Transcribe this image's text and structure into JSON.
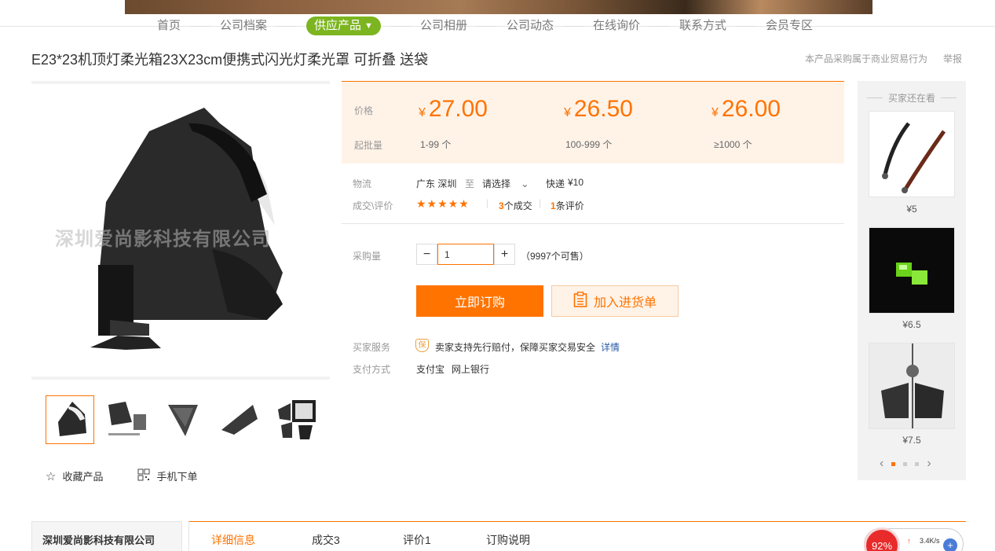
{
  "nav": {
    "items": [
      "首页",
      "公司档案",
      "供应产品",
      "公司相册",
      "公司动态",
      "在线询价",
      "联系方式",
      "会员专区"
    ],
    "active_arrow": "▼"
  },
  "product": {
    "title": "E23*23机顶灯柔光箱23X23cm便携式闪光灯柔光罩 可折叠 送袋",
    "trade_note": "本产品采购属于商业贸易行为",
    "report": "举报",
    "watermark": "深圳爱尚影科技有限公司"
  },
  "pricing": {
    "price_label": "价格",
    "moq_label": "起批量",
    "currency": "¥",
    "tiers": [
      {
        "price": "27.00",
        "range": "1-99 个"
      },
      {
        "price": "26.50",
        "range": "100-999 个"
      },
      {
        "price": "26.00",
        "range": "≥1000 个"
      }
    ]
  },
  "logistics": {
    "label": "物流",
    "from": "广东 深圳",
    "to_word": "至",
    "select": "请选择",
    "express": "快递",
    "fee": "¥10"
  },
  "deals": {
    "label": "成交\\评价",
    "stars": "★★★★★",
    "count_num": "3",
    "count_text": "个成交",
    "review_num": "1",
    "review_text": "条评价"
  },
  "purchase": {
    "label": "采购量",
    "qty": "1",
    "stock": "（9997个可售）",
    "buy_now": "立即订购",
    "add_cart": "加入进货单"
  },
  "service": {
    "label": "买家服务",
    "badge": "保",
    "text": "卖家支持先行赔付，保障买家交易安全",
    "detail": "详情",
    "pay_label": "支付方式",
    "pay1": "支付宝",
    "pay2": "网上银行"
  },
  "gallery_actions": {
    "favorite": "收藏产品",
    "mobile": "手机下单"
  },
  "sidebar": {
    "title": "买家还在看",
    "items": [
      {
        "price": "¥5"
      },
      {
        "price": "¥6.5"
      },
      {
        "price": "¥7.5"
      }
    ]
  },
  "bottom": {
    "company": "深圳爱尚影科技有限公司",
    "tabs": [
      "详细信息",
      "成交3",
      "评价1",
      "订购说明"
    ]
  },
  "widget": {
    "percent": "92%",
    "speed": "3.4K/s"
  },
  "colors": {
    "accent": "#ff7300",
    "nav_active": "#7cb51f"
  }
}
